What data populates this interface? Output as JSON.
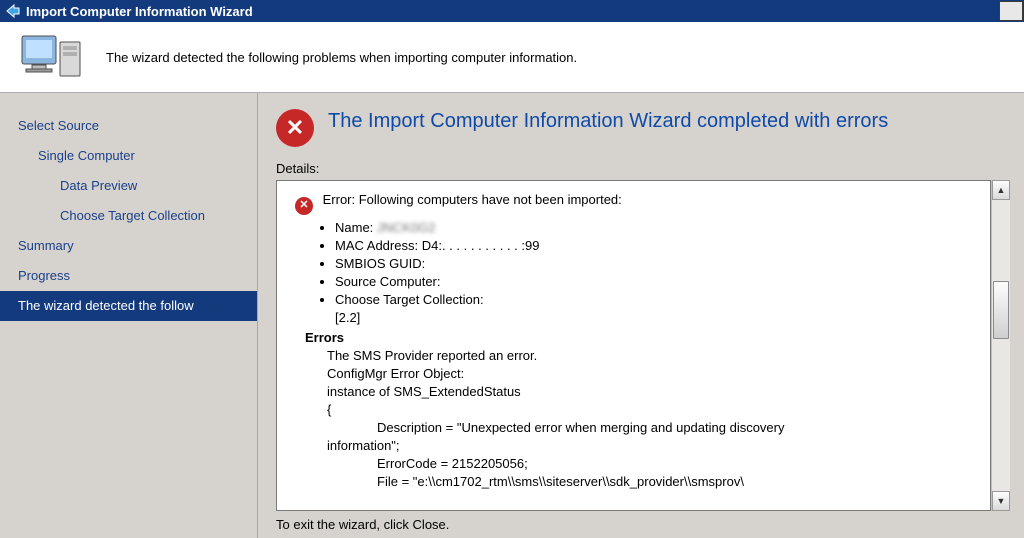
{
  "window": {
    "title": "Import Computer Information Wizard"
  },
  "banner": {
    "message": "The wizard detected the following problems when importing computer information."
  },
  "sidebar": {
    "steps": [
      {
        "label": "Select Source",
        "indent": 0
      },
      {
        "label": "Single Computer",
        "indent": 1
      },
      {
        "label": "Data Preview",
        "indent": 2
      },
      {
        "label": "Choose Target Collection",
        "indent": 2
      },
      {
        "label": "Summary",
        "indent": 0
      },
      {
        "label": "Progress",
        "indent": 0
      },
      {
        "label": "The wizard detected the follow",
        "indent": 0,
        "active": true
      }
    ]
  },
  "result": {
    "title": "The Import Computer Information Wizard completed with errors",
    "details_label": "Details:",
    "error_heading": "Error: Following computers have not been imported:",
    "computer": {
      "name_label": "Name:",
      "name_value": "JNCK0G2",
      "mac_label": "MAC Address:",
      "mac_value": "D4:. . . . . . . . . . . :99",
      "smbios_label": "SMBIOS GUID:",
      "smbios_value": "",
      "source_label": "Source Computer:",
      "source_value": "",
      "target_label": "Choose Target Collection:",
      "target_value": "",
      "target_extra": "[2.2]"
    },
    "errors_header": "Errors",
    "errors_body": {
      "line1": "The SMS Provider reported an error.",
      "line2": "ConfigMgr Error Object:",
      "line3": "instance of SMS_ExtendedStatus",
      "line4": "{",
      "desc_label": "Description",
      "desc_value": "\"Unexpected error when merging and updating discovery",
      "desc_cont": "information\";",
      "ecode_label": "ErrorCode",
      "ecode_value": "2152205056;",
      "file_label": "File",
      "file_value": "\"e:\\\\cm1702_rtm\\\\sms\\\\siteserver\\\\sdk_provider\\\\smsprov\\"
    },
    "footer": "To exit the wizard, click Close."
  }
}
